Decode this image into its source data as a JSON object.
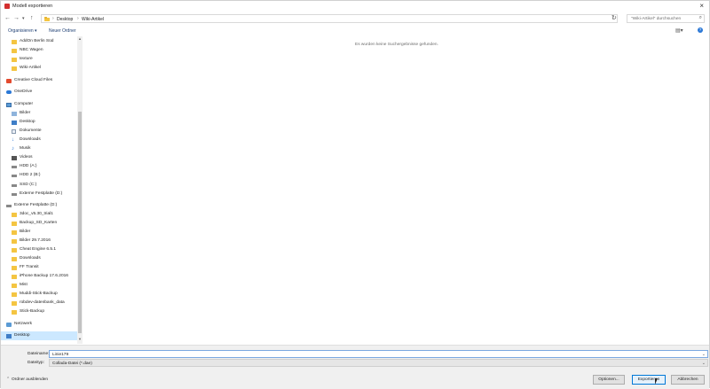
{
  "window": {
    "title": "Modell exportieren"
  },
  "address": {
    "crumbs": [
      "Desktop",
      "Wiki-Artikel"
    ],
    "search_placeholder": "\"Wiki-Artikel\" durchsuchen"
  },
  "toolbar": {
    "organize_label": "Organisieren ▾",
    "new_folder_label": "Neuer Ordner"
  },
  "nav": {
    "items": [
      {
        "label": "AddOn Berlin Süd",
        "icon": "folder-icon",
        "kind": "folder"
      },
      {
        "label": "NBC Wagen",
        "icon": "folder-icon",
        "kind": "folder"
      },
      {
        "label": "texture",
        "icon": "folder-icon",
        "kind": "folder"
      },
      {
        "label": "Wiki-Artikel",
        "icon": "folder-icon",
        "kind": "folder"
      },
      {
        "label": "Creative Cloud Files",
        "icon": "creative-cloud-icon",
        "kind": "cc"
      },
      {
        "label": "OneDrive",
        "icon": "onedrive-icon",
        "kind": "cloud"
      },
      {
        "label": "Computer",
        "icon": "computer-icon",
        "kind": "pc"
      },
      {
        "label": "Bilder",
        "icon": "pictures-icon",
        "kind": "bilder"
      },
      {
        "label": "Desktop",
        "icon": "desktop-icon",
        "kind": "desk"
      },
      {
        "label": "Dokumente",
        "icon": "documents-icon",
        "kind": "doc"
      },
      {
        "label": "Downloads",
        "icon": "downloads-icon",
        "kind": "dl"
      },
      {
        "label": "Musik",
        "icon": "music-icon",
        "kind": "music"
      },
      {
        "label": "Videos",
        "icon": "videos-icon",
        "kind": "video"
      },
      {
        "label": "HDD (A:)",
        "icon": "drive-icon",
        "kind": "drive"
      },
      {
        "label": "HDD 2 (B:)",
        "icon": "drive-icon",
        "kind": "drive"
      },
      {
        "label": "SSD (C:)",
        "icon": "drive-icon",
        "kind": "drive"
      },
      {
        "label": "Externe Festplatte (D:)",
        "icon": "drive-icon",
        "kind": "drive"
      },
      {
        "label": "Externe Festplatte (D:)",
        "icon": "drive-icon",
        "kind": "drive"
      },
      {
        "label": "3doc_v5.30_trial1",
        "icon": "folder-icon",
        "kind": "folder"
      },
      {
        "label": "Backup_SD_Karten",
        "icon": "folder-icon",
        "kind": "folder"
      },
      {
        "label": "Bilder",
        "icon": "folder-icon",
        "kind": "folder"
      },
      {
        "label": "Bilder 29.7.2016",
        "icon": "folder-icon",
        "kind": "folder"
      },
      {
        "label": "Cheat Engine 6.5.1",
        "icon": "folder-icon",
        "kind": "folder"
      },
      {
        "label": "Downloads",
        "icon": "folder-icon",
        "kind": "folder"
      },
      {
        "label": "FF Transit",
        "icon": "folder-icon",
        "kind": "folder"
      },
      {
        "label": "iPhone Backup 17.6.2016",
        "icon": "folder-icon",
        "kind": "folder"
      },
      {
        "label": "Mist",
        "icon": "folder-icon",
        "kind": "folder"
      },
      {
        "label": "Muddi-Stick-Backup",
        "icon": "folder-icon",
        "kind": "folder"
      },
      {
        "label": "robdev-datenbank_data",
        "icon": "folder-icon",
        "kind": "folder"
      },
      {
        "label": "Stick-Backup",
        "icon": "folder-icon",
        "kind": "folder"
      },
      {
        "label": "Netzwerk",
        "icon": "network-icon",
        "kind": "net"
      },
      {
        "label": "Desktop",
        "icon": "desktop-icon",
        "kind": "desk",
        "selected": true
      }
    ]
  },
  "content": {
    "empty_message": "Es wurden keine Suchergebnisse gefunden."
  },
  "form": {
    "filename_label": "Dateiname:",
    "filename_value": "Linie179",
    "filetype_label": "Dateityp:",
    "filetype_value": "Collada-Datei (*.dae)"
  },
  "footer": {
    "hide_folders_label": "Ordner ausblenden",
    "options_label": "Optionen...",
    "export_label": "Exportieren",
    "cancel_label": "Abbrechen"
  }
}
